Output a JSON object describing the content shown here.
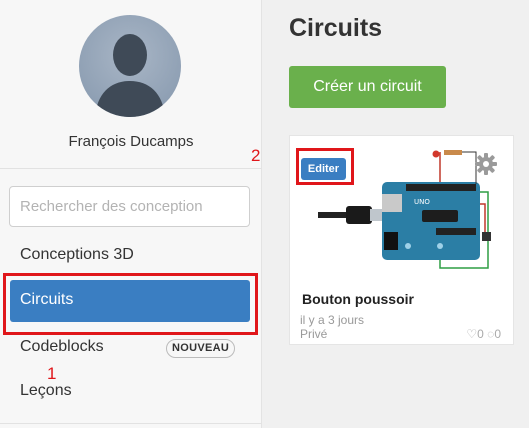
{
  "user": {
    "name": "François Ducamps"
  },
  "search": {
    "placeholder": "Rechercher des conception"
  },
  "nav": {
    "items": [
      {
        "label": "Conceptions 3D"
      },
      {
        "label": "Circuits"
      },
      {
        "label": "Codeblocks",
        "badge": "NOUVEAU"
      },
      {
        "label": "Leçons"
      }
    ]
  },
  "annotations": {
    "marker_1": "1",
    "marker_2": "2"
  },
  "main": {
    "title": "Circuits",
    "create_button": "Créer un circuit"
  },
  "card": {
    "edit_label": "Editer",
    "title": "Bouton poussoir",
    "time": "il y a 3 jours",
    "privacy": "Privé",
    "likes": "0",
    "comments": "0"
  },
  "colors": {
    "accent_blue": "#3a7ec2",
    "create_green": "#6ab04c",
    "highlight_red": "#e0161a"
  }
}
